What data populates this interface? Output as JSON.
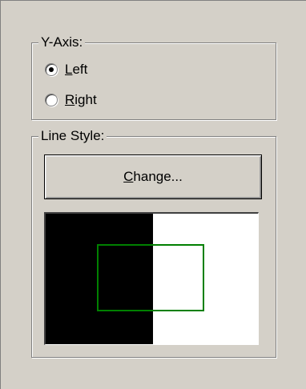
{
  "y_axis": {
    "label": "Y-Axis:",
    "options": [
      {
        "label": "Left",
        "mnemonic": "L",
        "rest": "eft",
        "selected": true
      },
      {
        "label": "Right",
        "mnemonic": "R",
        "rest": "ight",
        "selected": false
      }
    ]
  },
  "line_style": {
    "label": "Line Style:",
    "change_button": {
      "label": "Change...",
      "mnemonic": "C",
      "rest": "hange..."
    },
    "preview": {
      "left_background": "#000000",
      "right_background": "#ffffff",
      "line_color": "#008000"
    }
  },
  "theme": {
    "face": "#d4d0c8",
    "shadow": "#808080",
    "highlight": "#ffffff"
  }
}
